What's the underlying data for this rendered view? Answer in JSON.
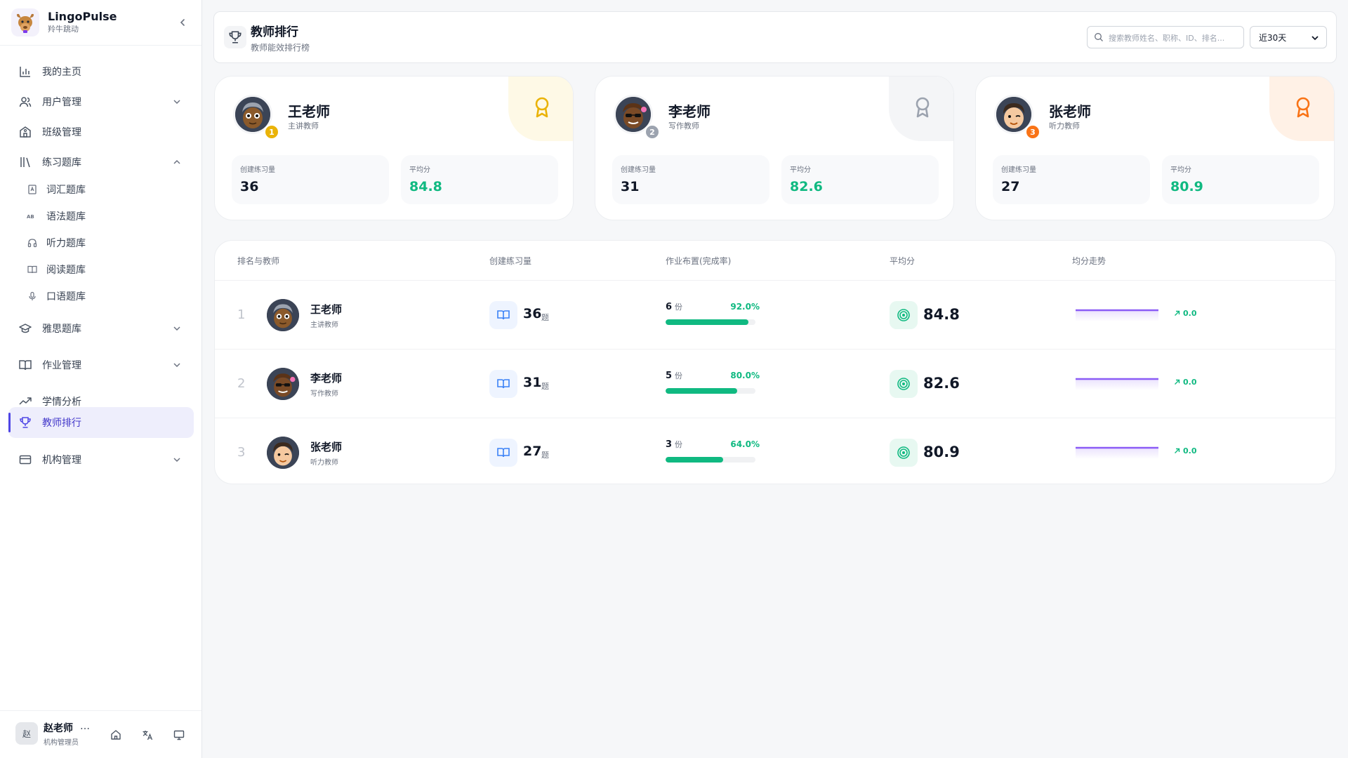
{
  "app": {
    "name": "LingoPulse",
    "subtitle": "羚牛跳动"
  },
  "sidebar": {
    "items": [
      {
        "label": "我的主页",
        "icon": "bar-chart-icon"
      },
      {
        "label": "用户管理",
        "icon": "users-icon"
      },
      {
        "label": "班级管理",
        "icon": "school-icon"
      },
      {
        "label": "练习题库",
        "icon": "library-icon"
      },
      {
        "label": "雅思题库",
        "icon": "graduation-cap-icon"
      },
      {
        "label": "作业管理",
        "icon": "book-open-icon"
      },
      {
        "label": "学情分析",
        "icon": "trending-up-icon"
      },
      {
        "label": "教师排行",
        "icon": "trophy-icon"
      },
      {
        "label": "机构管理",
        "icon": "card-icon"
      }
    ],
    "sub_items": [
      {
        "label": "词汇题库",
        "icon": "vocab-icon"
      },
      {
        "label": "语法题库",
        "icon": "grammar-icon"
      },
      {
        "label": "听力题库",
        "icon": "headphones-icon"
      },
      {
        "label": "阅读题库",
        "icon": "reading-icon"
      },
      {
        "label": "口语题库",
        "icon": "mic-icon"
      }
    ],
    "active": "教师排行"
  },
  "user": {
    "avatar_text": "赵",
    "name": "赵老师",
    "role": "机构管理员",
    "more": "…"
  },
  "header": {
    "title": "教师排行",
    "subtitle": "教师能效排行榜",
    "search_placeholder": "搜索教师姓名、职称、ID、排名...",
    "range_value": "近30天"
  },
  "podium": [
    {
      "rank": "1",
      "name": "王老师",
      "role": "主讲教师",
      "stat1_label": "创建练习量",
      "stat1_value": "36",
      "stat2_label": "平均分",
      "stat2_value": "84.8",
      "accent": "#eab308",
      "corner_bg": "#fef9e6"
    },
    {
      "rank": "2",
      "name": "李老师",
      "role": "写作教师",
      "stat1_label": "创建练习量",
      "stat1_value": "31",
      "stat2_label": "平均分",
      "stat2_value": "82.6",
      "accent": "#9ca3af",
      "corner_bg": "#f4f5f7"
    },
    {
      "rank": "3",
      "name": "张老师",
      "role": "听力教师",
      "stat1_label": "创建练习量",
      "stat1_value": "27",
      "stat2_label": "平均分",
      "stat2_value": "80.9",
      "accent": "#f97316",
      "corner_bg": "#fff1e6"
    }
  ],
  "table": {
    "columns": [
      "排名与教师",
      "创建练习量",
      "作业布置(完成率)",
      "平均分",
      "均分走势"
    ],
    "rows": [
      {
        "rank": "1",
        "name": "王老师",
        "role": "主讲教师",
        "questions": "36",
        "questions_unit": "题",
        "hw_count": "6",
        "hw_unit": "份",
        "hw_rate": "92.0%",
        "hw_rate_value": 92.0,
        "avg": "84.8",
        "trend": "0.0"
      },
      {
        "rank": "2",
        "name": "李老师",
        "role": "写作教师",
        "questions": "31",
        "questions_unit": "题",
        "hw_count": "5",
        "hw_unit": "份",
        "hw_rate": "80.0%",
        "hw_rate_value": 80.0,
        "avg": "82.6",
        "trend": "0.0"
      },
      {
        "rank": "3",
        "name": "张老师",
        "role": "听力教师",
        "questions": "27",
        "questions_unit": "题",
        "hw_count": "3",
        "hw_unit": "份",
        "hw_rate": "64.0%",
        "hw_rate_value": 64.0,
        "avg": "80.9",
        "trend": "0.0"
      }
    ]
  },
  "colors": {
    "primary": "#4f46e5",
    "success": "#10b981",
    "trend_line": "#8b5cf6"
  }
}
